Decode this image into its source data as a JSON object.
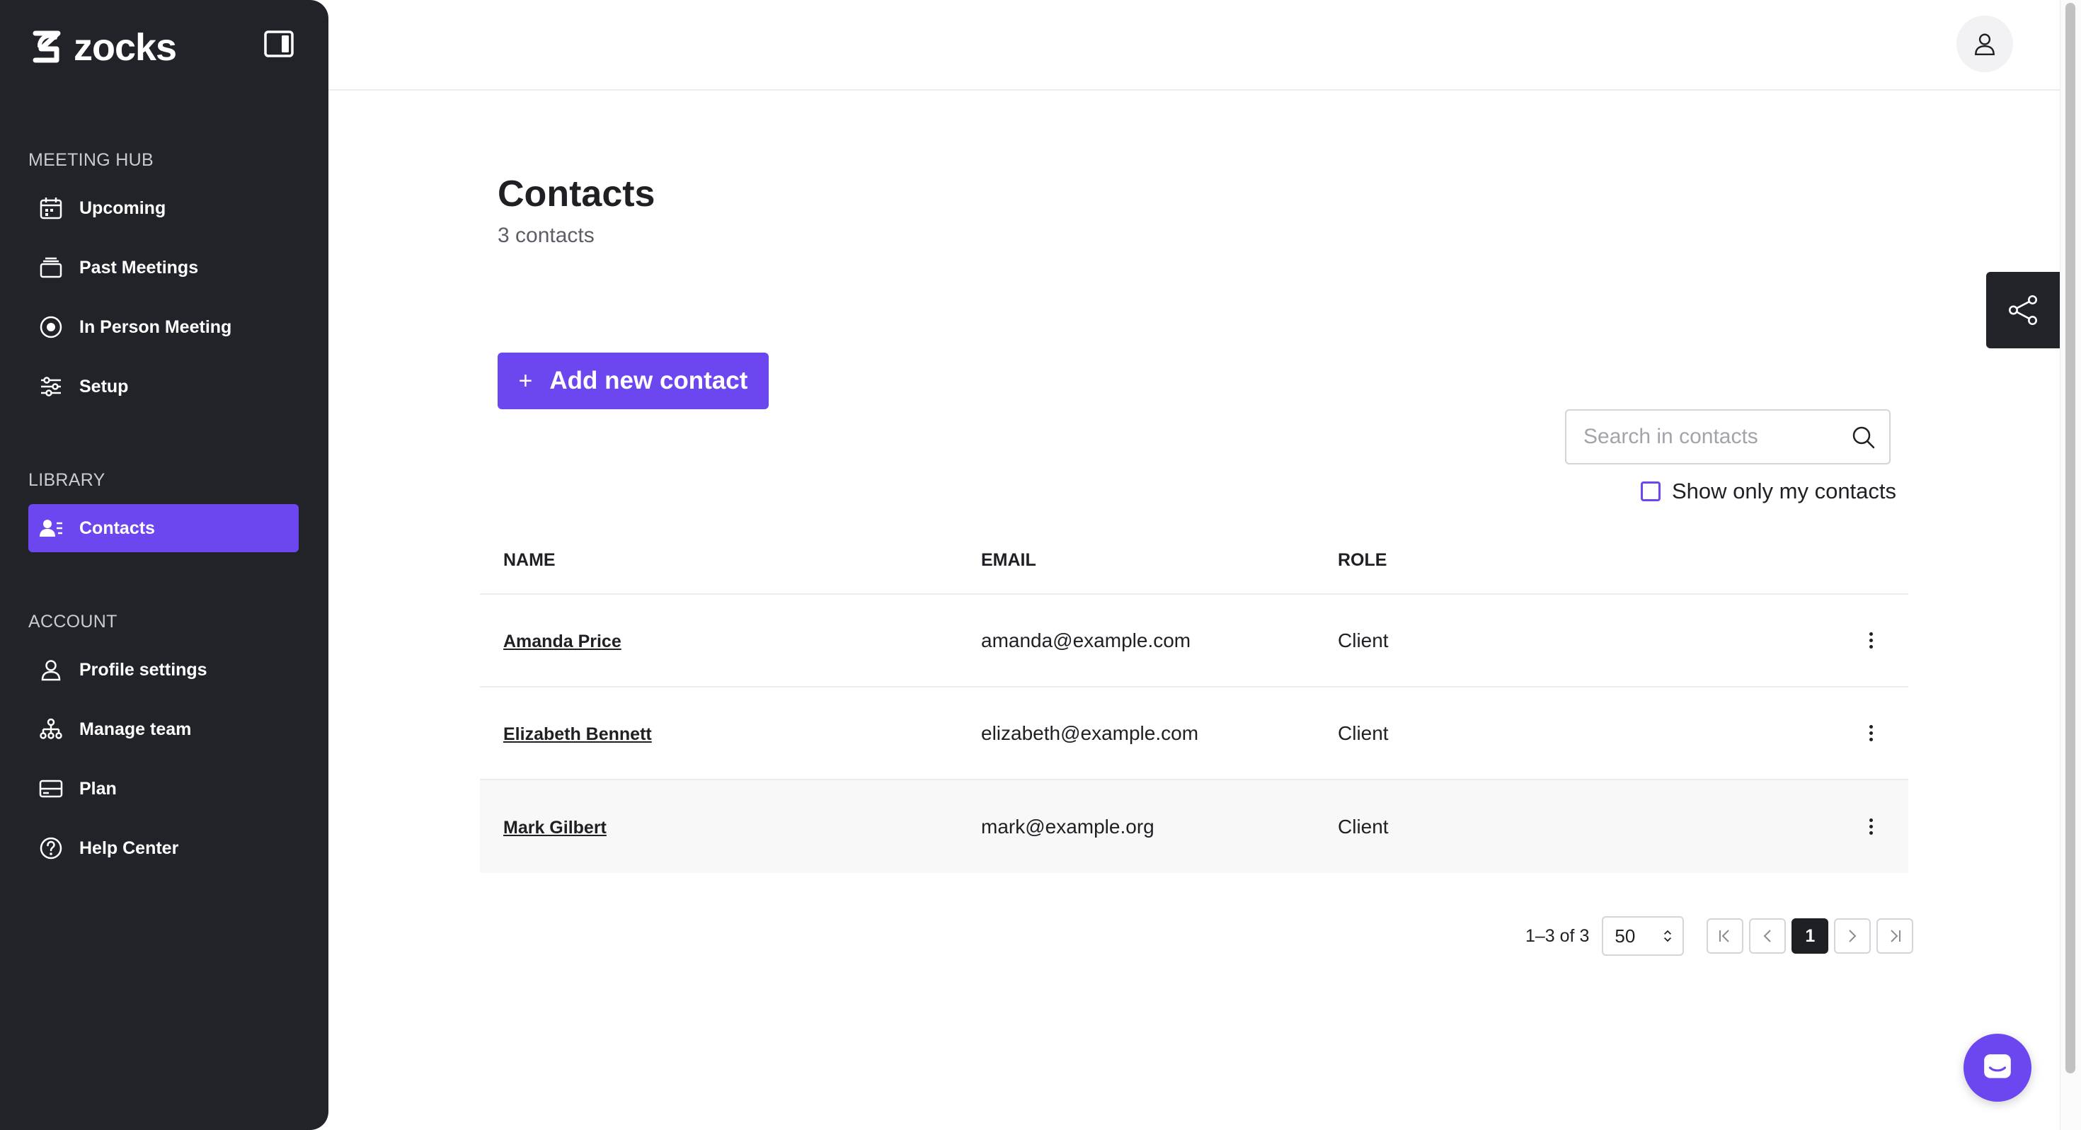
{
  "app": {
    "name": "zocks",
    "brand_color": "#6c47ef",
    "sidebar_bg": "#212328"
  },
  "sidebar": {
    "sections": [
      {
        "label": "MEETING HUB",
        "items": [
          {
            "label": "Upcoming",
            "icon": "calendar-icon"
          },
          {
            "label": "Past Meetings",
            "icon": "stack-icon"
          },
          {
            "label": "In Person Meeting",
            "icon": "record-icon"
          },
          {
            "label": "Setup",
            "icon": "sliders-icon"
          }
        ]
      },
      {
        "label": "LIBRARY",
        "items": [
          {
            "label": "Contacts",
            "icon": "contacts-icon",
            "active": true
          }
        ]
      },
      {
        "label": "ACCOUNT",
        "items": [
          {
            "label": "Profile settings",
            "icon": "user-icon"
          },
          {
            "label": "Manage team",
            "icon": "team-icon"
          },
          {
            "label": "Plan",
            "icon": "card-icon"
          },
          {
            "label": "Help Center",
            "icon": "help-icon"
          }
        ]
      }
    ]
  },
  "main": {
    "title": "Contacts",
    "subtitle": "3 contacts",
    "add_button_label": "Add new contact",
    "search_placeholder": "Search in contacts",
    "only_mine_label": "Show only my contacts",
    "only_mine_checked": false,
    "table": {
      "columns": [
        "NAME",
        "EMAIL",
        "ROLE"
      ],
      "rows": [
        {
          "name": "Amanda Price",
          "email": "amanda@example.com",
          "role": "Client"
        },
        {
          "name": "Elizabeth Bennett",
          "email": "elizabeth@example.com",
          "role": "Client"
        },
        {
          "name": "Mark Gilbert",
          "email": "mark@example.org",
          "role": "Client"
        }
      ]
    },
    "pagination": {
      "range": "1–3 of 3",
      "per_page": "50",
      "current_page": "1"
    }
  }
}
